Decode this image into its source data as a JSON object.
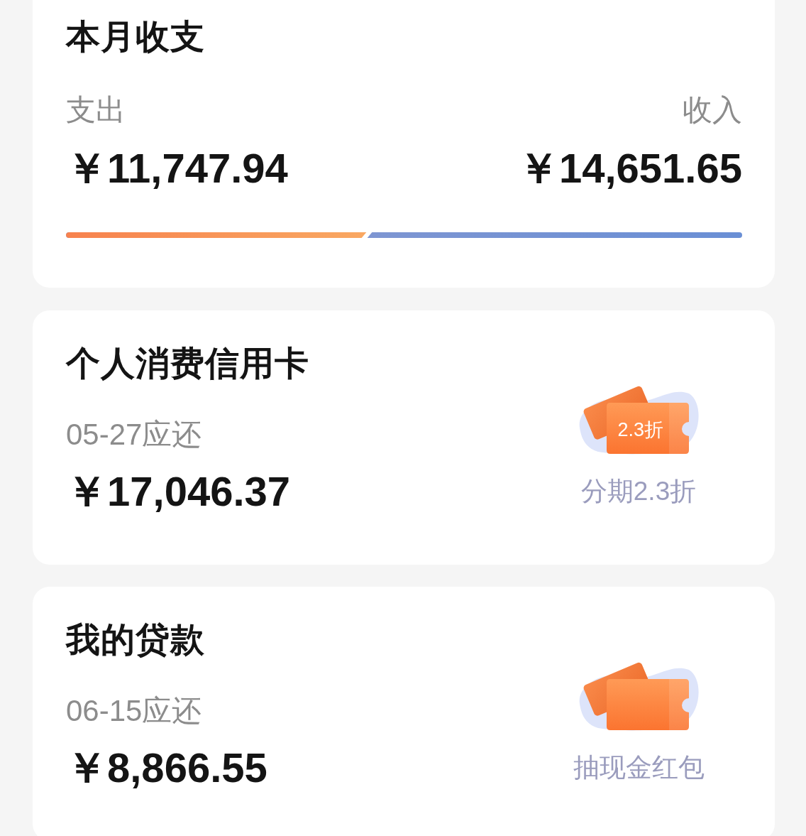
{
  "cards": [
    {
      "kind": "summary",
      "title": "本月收支",
      "expense": {
        "label": "支出",
        "amount": "￥11,747.94"
      },
      "income": {
        "label": "收入",
        "amount": "￥14,651.65"
      },
      "level": 0.445
    },
    {
      "kind": "bill",
      "title": "个人消费信用卡",
      "due": "05-27应还",
      "amount": "￥17,046.37",
      "promo": {
        "badge": "2.3折",
        "label": "分期2.3折"
      }
    },
    {
      "kind": "bill",
      "title": "我的贷款",
      "due": "06-15应还",
      "amount": "￥8,866.55",
      "promo": {
        "label": "抽现金红包"
      }
    }
  ]
}
